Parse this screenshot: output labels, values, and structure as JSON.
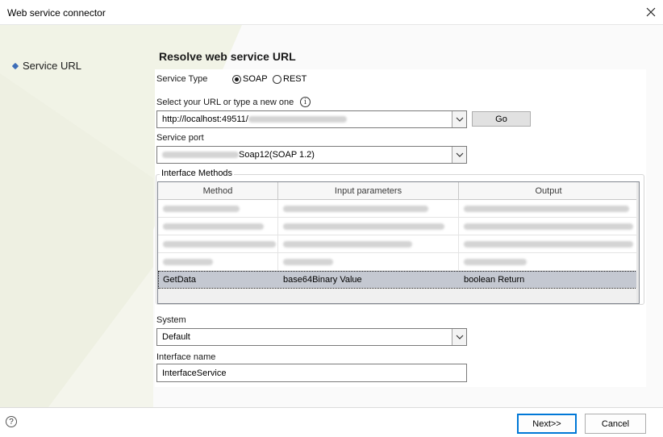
{
  "window": {
    "title": "Web service connector"
  },
  "nav": {
    "items": [
      {
        "label": "Service URL"
      }
    ]
  },
  "page": {
    "heading": "Resolve web service URL"
  },
  "service_type": {
    "label": "Service Type",
    "options": [
      {
        "label": "SOAP",
        "selected": true
      },
      {
        "label": "REST",
        "selected": false
      }
    ]
  },
  "url": {
    "label": "Select your URL or type a new one",
    "value_prefix": "http://localhost:49511/",
    "go_label": "Go"
  },
  "service_port": {
    "label": "Service port",
    "value_suffix": "Soap12(SOAP 1.2)"
  },
  "interface_methods": {
    "label": "Interface Methods",
    "columns": [
      "Method",
      "Input parameters",
      "Output"
    ],
    "selected_row": {
      "method": "GetData",
      "input": "base64Binary Value",
      "output": "boolean Return"
    }
  },
  "system": {
    "label": "System",
    "value": "Default"
  },
  "interface_name": {
    "label": "Interface name",
    "value": "InterfaceService"
  },
  "footer": {
    "next_label": "Next>>",
    "cancel_label": "Cancel"
  }
}
